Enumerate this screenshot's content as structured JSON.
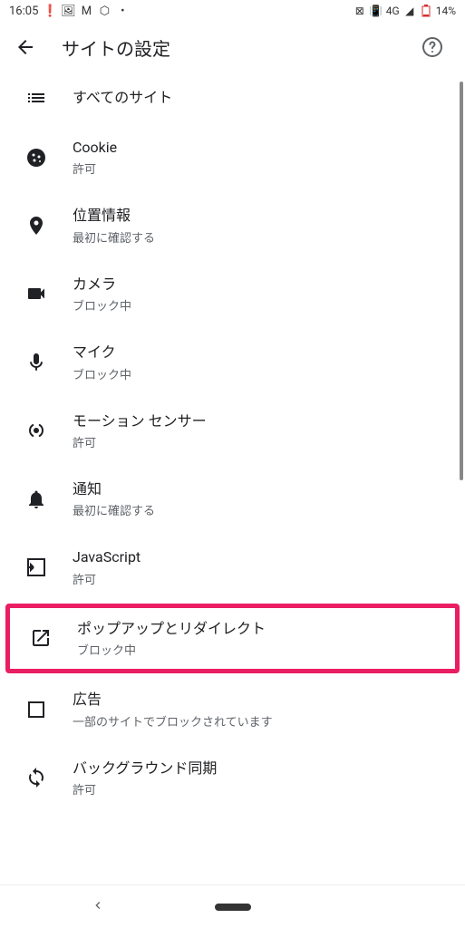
{
  "status_bar": {
    "time": "16:05",
    "network": "4G",
    "battery": "14%"
  },
  "header": {
    "title": "サイトの設定"
  },
  "settings": [
    {
      "id": "all-sites",
      "icon": "list",
      "title": "すべてのサイト",
      "subtitle": ""
    },
    {
      "id": "cookie",
      "icon": "cookie",
      "title": "Cookie",
      "subtitle": "許可"
    },
    {
      "id": "location",
      "icon": "location",
      "title": "位置情報",
      "subtitle": "最初に確認する"
    },
    {
      "id": "camera",
      "icon": "camera",
      "title": "カメラ",
      "subtitle": "ブロック中"
    },
    {
      "id": "mic",
      "icon": "mic",
      "title": "マイク",
      "subtitle": "ブロック中"
    },
    {
      "id": "motion",
      "icon": "motion",
      "title": "モーション センサー",
      "subtitle": "許可"
    },
    {
      "id": "notifications",
      "icon": "bell",
      "title": "通知",
      "subtitle": "最初に確認する"
    },
    {
      "id": "javascript",
      "icon": "javascript",
      "title": "JavaScript",
      "subtitle": "許可"
    },
    {
      "id": "popups",
      "icon": "popup",
      "title": "ポップアップとリダイレクト",
      "subtitle": "ブロック中",
      "highlighted": true
    },
    {
      "id": "ads",
      "icon": "square",
      "title": "広告",
      "subtitle": "一部のサイトでブロックされています"
    },
    {
      "id": "background-sync",
      "icon": "sync",
      "title": "バックグラウンド同期",
      "subtitle": "許可"
    }
  ]
}
